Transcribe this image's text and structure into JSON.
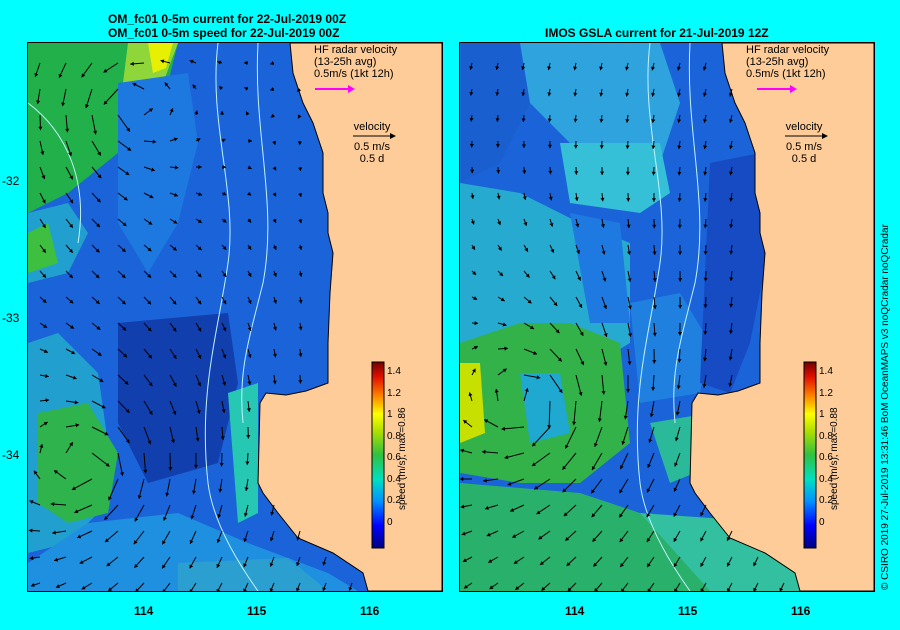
{
  "left_panel": {
    "title_line1": "OM_fc01 0-5m current for 22-Jul-2019 00Z",
    "title_line2": "OM_fc01 0-5m speed for 22-Jul-2019 00Z",
    "max_label": "speed (m/s),  max=0.86"
  },
  "right_panel": {
    "title_line1": "IMOS GSLA current for 21-Jul-2019 12Z",
    "max_label": "speed (m/s),  max=0.88"
  },
  "hf_legend": {
    "line1": "HF radar velocity",
    "line2": "(13-25h avg)",
    "line3": "0.5m/s (1kt 12h)"
  },
  "velocity_legend": {
    "line1": "velocity",
    "line2": "0.5 m/s",
    "line3": "0.5 d"
  },
  "lat_labels": [
    "-32",
    "-33",
    "-34"
  ],
  "lon_labels": [
    "114",
    "115",
    "116"
  ],
  "colorbar_ticks": [
    "1.4",
    "1.2",
    "1",
    "0.8",
    "0.6",
    "0.4",
    "0.2",
    "0"
  ],
  "credit": "© CSIRO 2019   27-Jul-2019 13:31:46 BoM OceanMAPS v3 noQCradar noQCradar",
  "colors": {
    "land": "#fecc99",
    "background": "#00ffff",
    "hf_arrow": "#ff00ff"
  }
}
